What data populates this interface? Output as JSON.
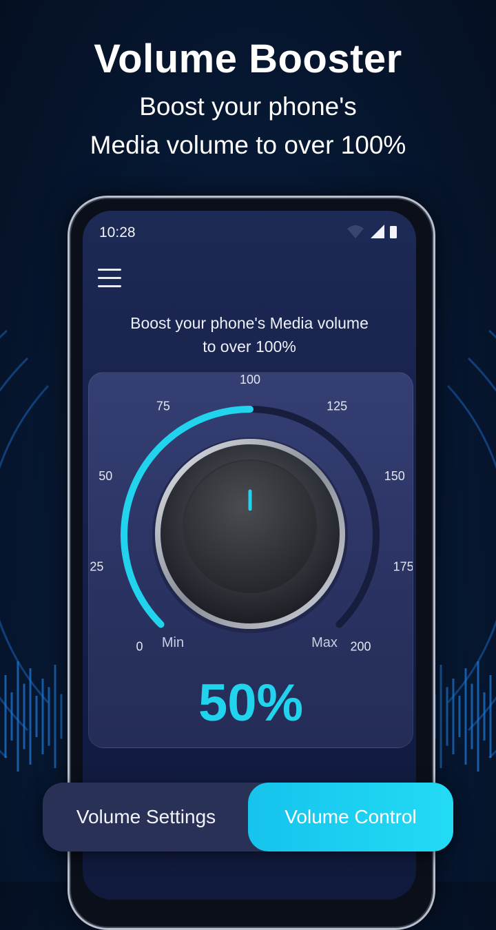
{
  "promo": {
    "title": "Volume Booster",
    "subtitle_line1": "Boost your phone's",
    "subtitle_line2": "Media volume to over 100%"
  },
  "status_bar": {
    "time": "10:28",
    "icons": [
      "wifi-icon",
      "signal-icon",
      "battery-icon"
    ]
  },
  "app": {
    "menu_icon": "hamburger-menu-icon",
    "description_line1": "Boost your phone's Media volume",
    "description_line2": "to over 100%"
  },
  "dial": {
    "ticks": [
      "0",
      "25",
      "50",
      "75",
      "100",
      "125",
      "150",
      "175",
      "200"
    ],
    "min_label": "Min",
    "max_label": "Max",
    "percent_text": "50%",
    "level_fraction": 0.5,
    "accent_color": "#22d3ee"
  },
  "tabs": {
    "settings_label": "Volume Settings",
    "control_label": "Volume Control",
    "active": "Volume Control"
  }
}
